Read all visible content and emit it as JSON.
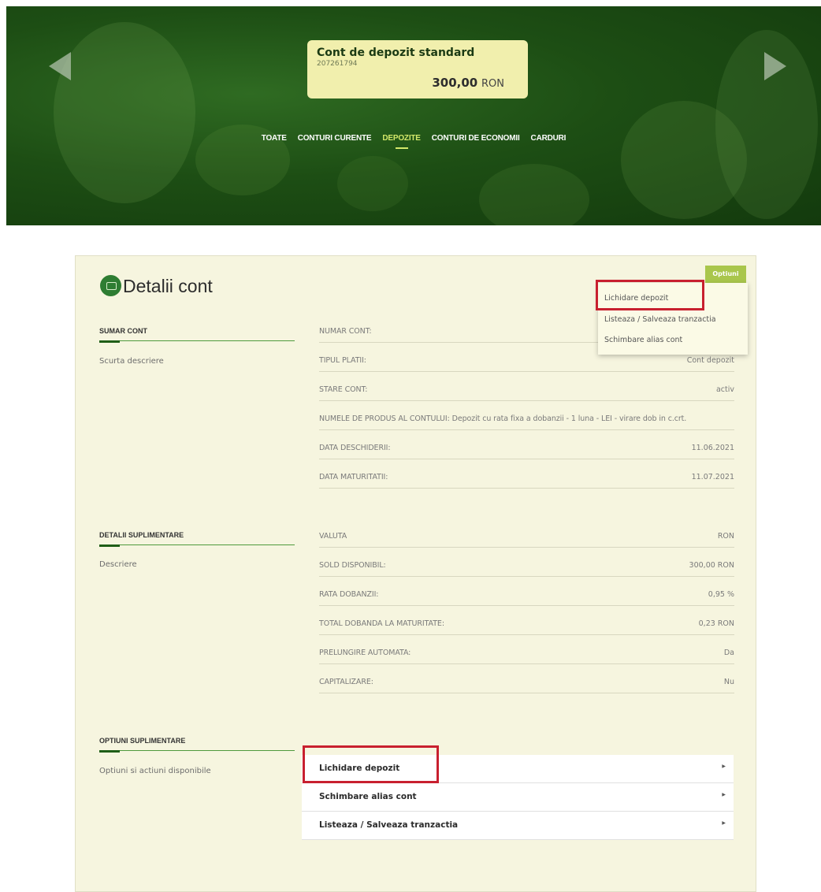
{
  "account_card": {
    "name": "Cont de depozit standard",
    "number": "207261794",
    "balance": "300,00",
    "currency": "RON"
  },
  "tabs": [
    "TOATE",
    "CONTURI CURENTE",
    "DEPOZITE",
    "CONTURI DE ECONOMII",
    "CARDURI"
  ],
  "active_tab": "DEPOZITE",
  "panel": {
    "title": "Detalii cont",
    "options_button": "Optiuni",
    "options_menu": [
      "Lichidare depozit",
      "Listeaza / Salveaza tranzactia",
      "Schimbare alias cont"
    ]
  },
  "sections": {
    "summary": {
      "heading": "SUMAR CONT",
      "description": "Scurta descriere"
    },
    "extra": {
      "heading": "DETALII SUPLIMENTARE",
      "description": "Descriere"
    },
    "options": {
      "heading": "OPTIUNI SUPLIMENTARE",
      "description": "Optiuni si actiuni disponibile"
    }
  },
  "summary_rows": [
    {
      "label": "NUMAR CONT:",
      "value": ""
    },
    {
      "label": "TIPUL PLATII:",
      "value": "Cont depozit"
    },
    {
      "label": "STARE CONT:",
      "value": "activ"
    },
    {
      "label": "NUMELE DE PRODUS AL CONTULUI:  Depozit cu rata fixa a dobanzii - 1 luna - LEI - virare dob in c.crt.",
      "value": ""
    },
    {
      "label": "DATA DESCHIDERII:",
      "value": "11.06.2021"
    },
    {
      "label": "DATA MATURITATII:",
      "value": "11.07.2021"
    }
  ],
  "extra_rows": [
    {
      "label": "VALUTA",
      "value": "RON"
    },
    {
      "label": "SOLD DISPONIBIL:",
      "value": "300,00 RON"
    },
    {
      "label": "RATA DOBANZII:",
      "value": "0,95 %"
    },
    {
      "label": "TOTAL DOBANDA LA MATURITATE:",
      "value": "0,23 RON"
    },
    {
      "label": "PRELUNGIRE AUTOMATA:",
      "value": "Da"
    },
    {
      "label": "CAPITALIZARE:",
      "value": "Nu"
    }
  ],
  "actions": [
    "Lichidare depozit",
    "Schimbare alias cont",
    "Listeaza / Salveaza tranzactia"
  ],
  "colors": {
    "banner_green": "#1d4e14",
    "card_yellow": "#f1efad",
    "panel_bg": "#f6f5df",
    "accent_green": "#a9c64c",
    "highlight_red": "#c8202f"
  }
}
